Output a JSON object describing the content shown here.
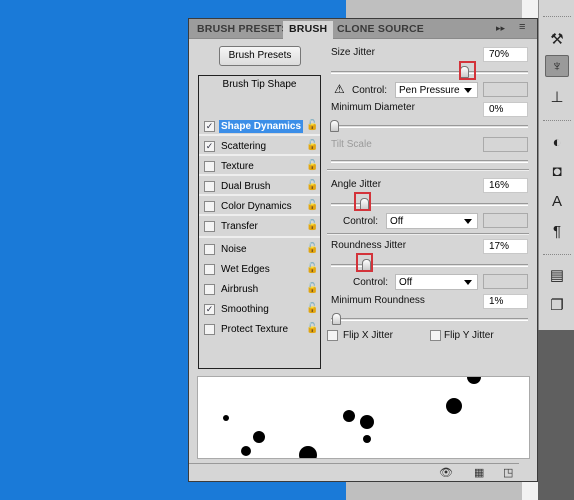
{
  "tabs": [
    {
      "label": "BRUSH PRESETS",
      "active": false
    },
    {
      "label": "BRUSH",
      "active": true
    },
    {
      "label": "CLONE SOURCE",
      "active": false
    }
  ],
  "tab_menu_icons": [
    "double-arrow-icon",
    "panel-menu-icon"
  ],
  "brush_presets_button": "Brush Presets",
  "brush_tip_shape": "Brush Tip Shape",
  "options": [
    {
      "label": "Shape Dynamics",
      "checked": true,
      "selected": true
    },
    {
      "label": "Scattering",
      "checked": true
    },
    {
      "label": "Texture",
      "checked": false
    },
    {
      "label": "Dual Brush",
      "checked": false
    },
    {
      "label": "Color Dynamics",
      "checked": false
    },
    {
      "label": "Transfer",
      "checked": false
    },
    {
      "label": "Noise",
      "checked": false
    },
    {
      "label": "Wet Edges",
      "checked": false
    },
    {
      "label": "Airbrush",
      "checked": false
    },
    {
      "label": "Smoothing",
      "checked": true
    },
    {
      "label": "Protect Texture",
      "checked": false
    }
  ],
  "size_jitter": {
    "label": "Size Jitter",
    "value": "70%",
    "level": 70,
    "control_label": "Control:",
    "control": "Pen Pressure",
    "warning_icon": "warning-icon"
  },
  "minimum_diameter": {
    "label": "Minimum Diameter",
    "value": "0%",
    "level": 0
  },
  "tilt_scale": {
    "label": "Tilt Scale",
    "disabled": true
  },
  "angle_jitter": {
    "label": "Angle Jitter",
    "value": "16%",
    "level": 16,
    "control_label": "Control:",
    "control": "Off"
  },
  "roundness_jitter": {
    "label": "Roundness Jitter",
    "value": "17%",
    "level": 17,
    "control_label": "Control:",
    "control": "Off"
  },
  "minimum_roundness": {
    "label": "Minimum Roundness",
    "value": "1%",
    "level": 1
  },
  "flip_x": {
    "label": "Flip X Jitter",
    "checked": false
  },
  "flip_y": {
    "label": "Flip Y Jitter",
    "checked": false
  },
  "highlight_color": "#d3333a",
  "selection_color": "#3b8ee8",
  "footer_icons": [
    "toggle-live-tip-preview-icon",
    "open-preset-manager-icon",
    "create-new-brush-icon"
  ],
  "dock_icons": [
    "brush-tool-icon",
    "brush-panel-icon",
    "clone-source-icon",
    "adjustments-icon",
    "masks-icon",
    "character-icon",
    "paragraph-icon",
    "info-icon",
    "layer-comps-icon"
  ]
}
